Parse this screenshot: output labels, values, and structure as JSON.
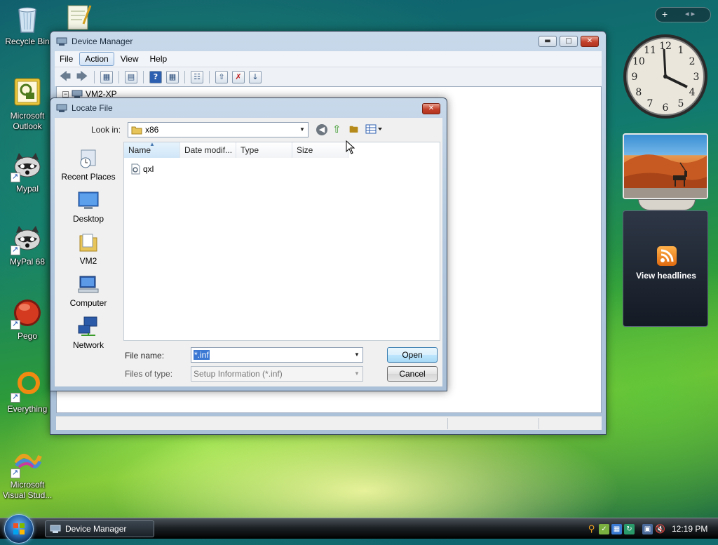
{
  "desktop": {
    "icons": [
      {
        "label": "Recycle Bin"
      },
      {
        "label": "Microsoft Outlook"
      },
      {
        "label": "Mypal"
      },
      {
        "label": "MyPal 68"
      },
      {
        "label": "Pego"
      },
      {
        "label": "Everything"
      },
      {
        "label": "Microsoft Visual Stud..."
      }
    ]
  },
  "sidebar": {
    "add_gadget": "+",
    "prev_next": "◂ ▸",
    "clock": {
      "numerals": [
        "12",
        "1",
        "2",
        "3",
        "4",
        "5",
        "6",
        "7",
        "8",
        "9",
        "10",
        "11"
      ]
    },
    "feed": {
      "label": "View headlines"
    }
  },
  "device_manager": {
    "title": "Device Manager",
    "menu": [
      "File",
      "Action",
      "View",
      "Help"
    ],
    "tree_root": "VM2-XP"
  },
  "locate_dialog": {
    "title": "Locate File",
    "look_in_label": "Look in:",
    "look_in_value": "x86",
    "places": [
      "Recent Places",
      "Desktop",
      "VM2",
      "Computer",
      "Network"
    ],
    "columns": [
      "Name",
      "Date modif...",
      "Type",
      "Size"
    ],
    "files": [
      "qxl"
    ],
    "file_name_label": "File name:",
    "file_name_value": "*.inf",
    "files_of_type_label": "Files of type:",
    "files_of_type_value": "Setup Information (*.inf)",
    "open_label": "Open",
    "cancel_label": "Cancel"
  },
  "taskbar": {
    "task_label": "Device Manager",
    "clock": "12:19 PM"
  },
  "colors": {
    "vista_glass": "#b5cadf",
    "accent_blue": "#3c7fb1",
    "close_red": "#c2402b"
  }
}
